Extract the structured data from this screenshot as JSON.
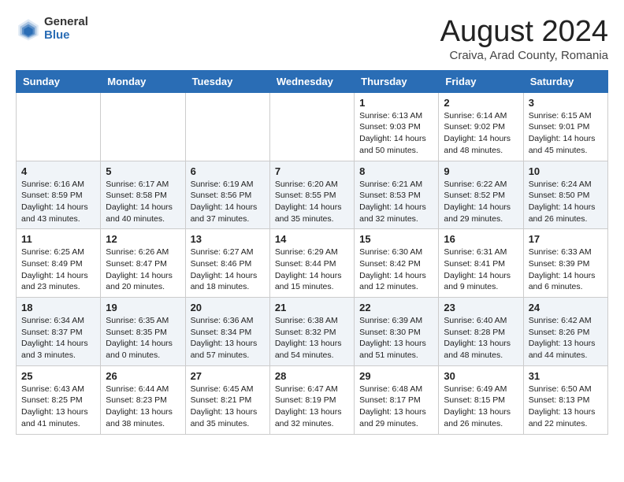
{
  "logo": {
    "general": "General",
    "blue": "Blue"
  },
  "title": {
    "month_year": "August 2024",
    "location": "Craiva, Arad County, Romania"
  },
  "weekdays": [
    "Sunday",
    "Monday",
    "Tuesday",
    "Wednesday",
    "Thursday",
    "Friday",
    "Saturday"
  ],
  "weeks": [
    [
      {
        "day": "",
        "info": ""
      },
      {
        "day": "",
        "info": ""
      },
      {
        "day": "",
        "info": ""
      },
      {
        "day": "",
        "info": ""
      },
      {
        "day": "1",
        "info": "Sunrise: 6:13 AM\nSunset: 9:03 PM\nDaylight: 14 hours\nand 50 minutes."
      },
      {
        "day": "2",
        "info": "Sunrise: 6:14 AM\nSunset: 9:02 PM\nDaylight: 14 hours\nand 48 minutes."
      },
      {
        "day": "3",
        "info": "Sunrise: 6:15 AM\nSunset: 9:01 PM\nDaylight: 14 hours\nand 45 minutes."
      }
    ],
    [
      {
        "day": "4",
        "info": "Sunrise: 6:16 AM\nSunset: 8:59 PM\nDaylight: 14 hours\nand 43 minutes."
      },
      {
        "day": "5",
        "info": "Sunrise: 6:17 AM\nSunset: 8:58 PM\nDaylight: 14 hours\nand 40 minutes."
      },
      {
        "day": "6",
        "info": "Sunrise: 6:19 AM\nSunset: 8:56 PM\nDaylight: 14 hours\nand 37 minutes."
      },
      {
        "day": "7",
        "info": "Sunrise: 6:20 AM\nSunset: 8:55 PM\nDaylight: 14 hours\nand 35 minutes."
      },
      {
        "day": "8",
        "info": "Sunrise: 6:21 AM\nSunset: 8:53 PM\nDaylight: 14 hours\nand 32 minutes."
      },
      {
        "day": "9",
        "info": "Sunrise: 6:22 AM\nSunset: 8:52 PM\nDaylight: 14 hours\nand 29 minutes."
      },
      {
        "day": "10",
        "info": "Sunrise: 6:24 AM\nSunset: 8:50 PM\nDaylight: 14 hours\nand 26 minutes."
      }
    ],
    [
      {
        "day": "11",
        "info": "Sunrise: 6:25 AM\nSunset: 8:49 PM\nDaylight: 14 hours\nand 23 minutes."
      },
      {
        "day": "12",
        "info": "Sunrise: 6:26 AM\nSunset: 8:47 PM\nDaylight: 14 hours\nand 20 minutes."
      },
      {
        "day": "13",
        "info": "Sunrise: 6:27 AM\nSunset: 8:46 PM\nDaylight: 14 hours\nand 18 minutes."
      },
      {
        "day": "14",
        "info": "Sunrise: 6:29 AM\nSunset: 8:44 PM\nDaylight: 14 hours\nand 15 minutes."
      },
      {
        "day": "15",
        "info": "Sunrise: 6:30 AM\nSunset: 8:42 PM\nDaylight: 14 hours\nand 12 minutes."
      },
      {
        "day": "16",
        "info": "Sunrise: 6:31 AM\nSunset: 8:41 PM\nDaylight: 14 hours\nand 9 minutes."
      },
      {
        "day": "17",
        "info": "Sunrise: 6:33 AM\nSunset: 8:39 PM\nDaylight: 14 hours\nand 6 minutes."
      }
    ],
    [
      {
        "day": "18",
        "info": "Sunrise: 6:34 AM\nSunset: 8:37 PM\nDaylight: 14 hours\nand 3 minutes."
      },
      {
        "day": "19",
        "info": "Sunrise: 6:35 AM\nSunset: 8:35 PM\nDaylight: 14 hours\nand 0 minutes."
      },
      {
        "day": "20",
        "info": "Sunrise: 6:36 AM\nSunset: 8:34 PM\nDaylight: 13 hours\nand 57 minutes."
      },
      {
        "day": "21",
        "info": "Sunrise: 6:38 AM\nSunset: 8:32 PM\nDaylight: 13 hours\nand 54 minutes."
      },
      {
        "day": "22",
        "info": "Sunrise: 6:39 AM\nSunset: 8:30 PM\nDaylight: 13 hours\nand 51 minutes."
      },
      {
        "day": "23",
        "info": "Sunrise: 6:40 AM\nSunset: 8:28 PM\nDaylight: 13 hours\nand 48 minutes."
      },
      {
        "day": "24",
        "info": "Sunrise: 6:42 AM\nSunset: 8:26 PM\nDaylight: 13 hours\nand 44 minutes."
      }
    ],
    [
      {
        "day": "25",
        "info": "Sunrise: 6:43 AM\nSunset: 8:25 PM\nDaylight: 13 hours\nand 41 minutes."
      },
      {
        "day": "26",
        "info": "Sunrise: 6:44 AM\nSunset: 8:23 PM\nDaylight: 13 hours\nand 38 minutes."
      },
      {
        "day": "27",
        "info": "Sunrise: 6:45 AM\nSunset: 8:21 PM\nDaylight: 13 hours\nand 35 minutes."
      },
      {
        "day": "28",
        "info": "Sunrise: 6:47 AM\nSunset: 8:19 PM\nDaylight: 13 hours\nand 32 minutes."
      },
      {
        "day": "29",
        "info": "Sunrise: 6:48 AM\nSunset: 8:17 PM\nDaylight: 13 hours\nand 29 minutes."
      },
      {
        "day": "30",
        "info": "Sunrise: 6:49 AM\nSunset: 8:15 PM\nDaylight: 13 hours\nand 26 minutes."
      },
      {
        "day": "31",
        "info": "Sunrise: 6:50 AM\nSunset: 8:13 PM\nDaylight: 13 hours\nand 22 minutes."
      }
    ]
  ]
}
